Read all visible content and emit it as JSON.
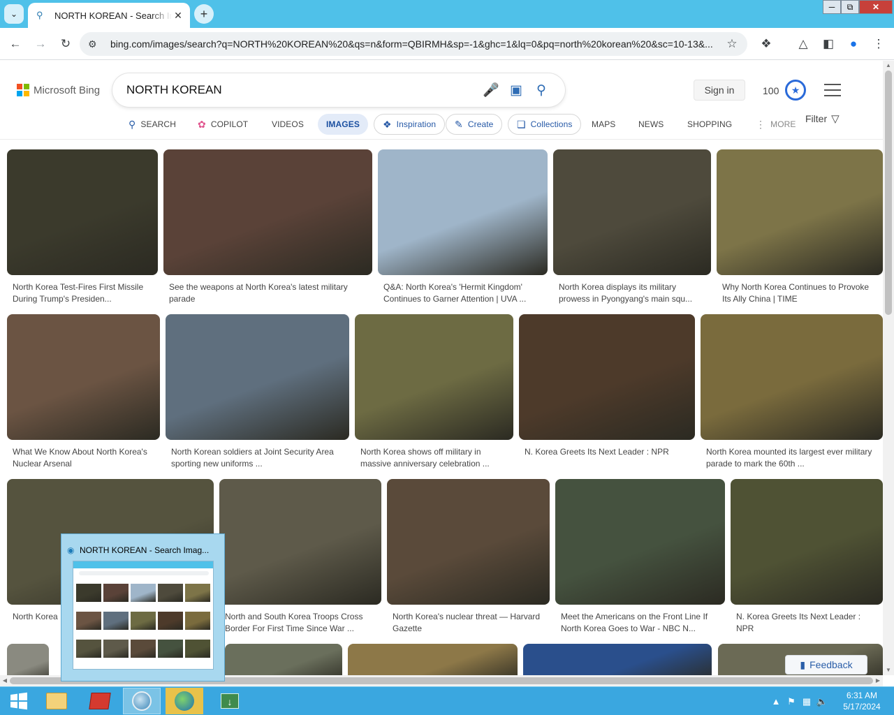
{
  "browser": {
    "tab_title": "NORTH KOREAN - Search Images",
    "url": "bing.com/images/search?q=NORTH%20KOREAN%20&qs=n&form=QBIRMH&sp=-1&ghc=1&lq=0&pq=north%20korean%20&sc=10-13&..."
  },
  "bing": {
    "brand": "Microsoft Bing",
    "query": "NORTH KOREAN",
    "sign_in": "Sign in",
    "rewards_points": "100",
    "filter_label": "Filter",
    "nav": [
      {
        "label": "SEARCH",
        "icon": "search-icon"
      },
      {
        "label": "COPILOT",
        "icon": "copilot-icon"
      },
      {
        "label": "VIDEOS"
      },
      {
        "label": "IMAGES",
        "active": true
      },
      {
        "label": "Inspiration",
        "icon": "inspiration-icon"
      },
      {
        "label": "Create",
        "icon": "create-icon"
      },
      {
        "label": "Collections",
        "icon": "collections-icon"
      },
      {
        "label": "MAPS"
      },
      {
        "label": "NEWS"
      },
      {
        "label": "SHOPPING"
      },
      {
        "label": "MORE",
        "icon": "more-dots-icon"
      }
    ],
    "feedback": "Feedback"
  },
  "results": [
    {
      "caption": "North Korea Test-Fires First Missile During Trump's Presiden...",
      "color": "#3b3a2c"
    },
    {
      "caption": "See the weapons at North Korea's latest military parade",
      "color": "#5a4238"
    },
    {
      "caption": "Q&A: North Korea's 'Hermit Kingdom' Continues to Garner Attention | UVA ...",
      "color": "#9fb5c9"
    },
    {
      "caption": "North Korea displays its military prowess in Pyongyang's main squ...",
      "color": "#4e4a3c"
    },
    {
      "caption": "Why North Korea Continues to Provoke Its Ally China | TIME",
      "color": "#7d7448"
    },
    {
      "caption": "What We Know About North Korea's Nuclear Arsenal",
      "color": "#6b5443"
    },
    {
      "caption": "North Korean soldiers at Joint Security Area sporting new uniforms ...",
      "color": "#5f6f7e"
    },
    {
      "caption": "North Korea shows off military in massive anniversary celebration ...",
      "color": "#6d6b43"
    },
    {
      "caption": "N. Korea Greets Its Next Leader : NPR",
      "color": "#4d3a2a"
    },
    {
      "caption": "North Korea mounted its largest ever military parade to mark the 60th ...",
      "color": "#7a6b3d"
    },
    {
      "caption": "North Korea ...",
      "color": "#55533e"
    },
    {
      "caption": "North and South Korea Troops Cross Border For First Time Since War ...",
      "color": "#5e5a4a"
    },
    {
      "caption": "North Korea's nuclear threat — Harvard Gazette",
      "color": "#5a4a3a"
    },
    {
      "caption": "Meet the Americans on the Front Line If North Korea Goes to War - NBC N...",
      "color": "#45523f"
    },
    {
      "caption": "N. Korea Greets Its Next Leader : NPR",
      "color": "#4f5234"
    }
  ],
  "bottom_row_colors": [
    "#8a8a80",
    "#6a6f5c",
    "#8d7848",
    "#2a4f8c",
    "#6b6a55"
  ],
  "taskbar": {
    "preview_title": "NORTH KOREAN - Search Imag...",
    "time": "6:31 AM",
    "date": "5/17/2024"
  }
}
